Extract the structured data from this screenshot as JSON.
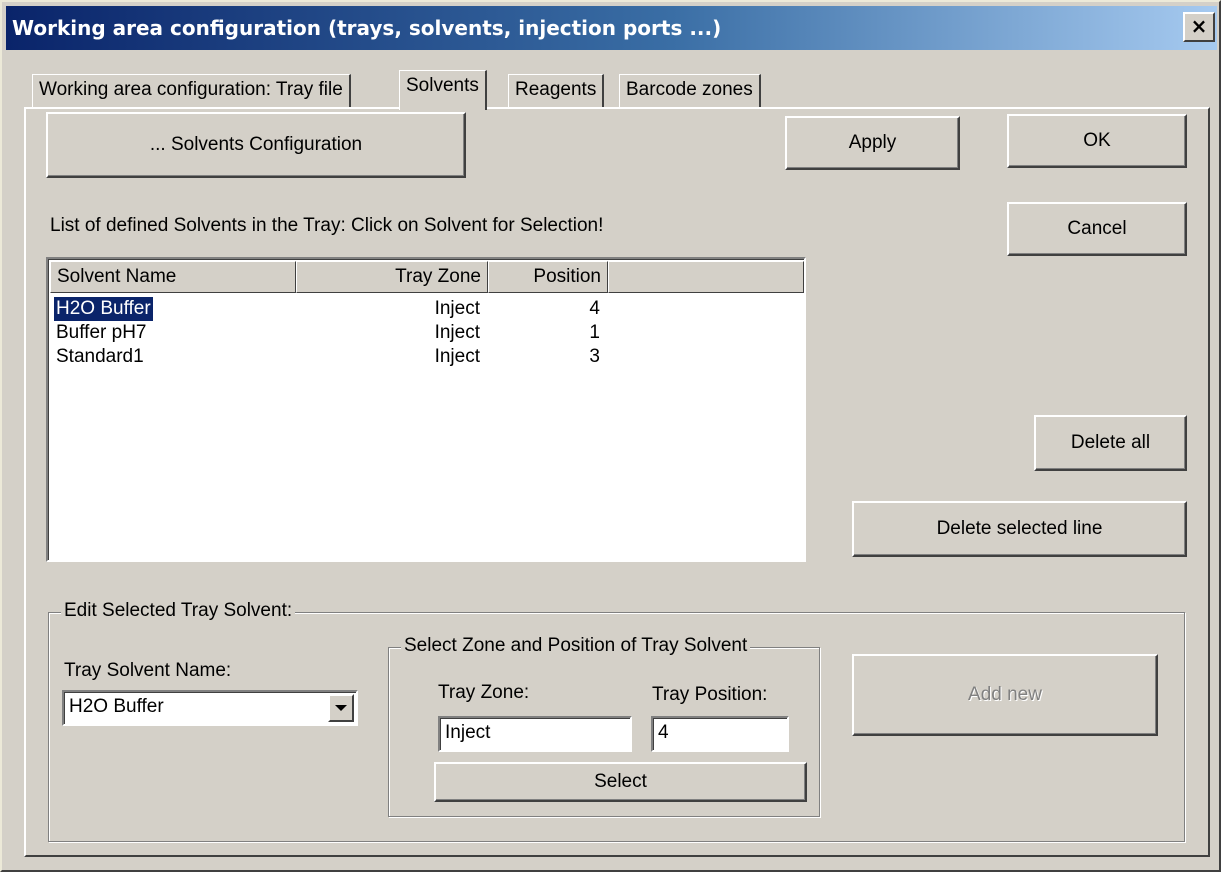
{
  "window": {
    "title": "Working area configuration (trays, solvents, injection ports ...)",
    "close_glyph": "×"
  },
  "tabs": [
    {
      "label": "Working area configuration: Tray file"
    },
    {
      "label": "Solvents",
      "active": true
    },
    {
      "label": "Reagents"
    },
    {
      "label": "Barcode zones"
    }
  ],
  "buttons": {
    "solvents_config": "... Solvents Configuration",
    "apply": "Apply",
    "ok": "OK",
    "cancel": "Cancel",
    "delete_all": "Delete all",
    "delete_selected": "Delete selected line",
    "add_new": "Add new",
    "select": "Select"
  },
  "list_caption": "List of defined Solvents in the Tray:  Click on Solvent for Selection!",
  "solvents_table": {
    "columns": [
      "Solvent Name",
      "Tray Zone",
      "Position"
    ],
    "rows": [
      {
        "name": "H2O Buffer",
        "zone": "Inject",
        "position": "4"
      },
      {
        "name": "Buffer pH7",
        "zone": "Inject",
        "position": "1"
      },
      {
        "name": "Standard1",
        "zone": "Inject",
        "position": "3"
      }
    ],
    "selected_row": 0
  },
  "edit_group": {
    "legend": "Edit Selected Tray Solvent:",
    "solvent_name_label": "Tray Solvent Name:",
    "solvent_name_value": "H2O Buffer",
    "zone_group": {
      "legend": "Select Zone and Position of Tray Solvent",
      "zone_label": "Tray Zone:",
      "zone_value": "Inject",
      "position_label": "Tray Position:",
      "position_value": "4"
    }
  },
  "colors": {
    "dialog_bg": "#d4d0c8",
    "title_start": "#0a246a",
    "title_end": "#a6caf0",
    "selection": "#0a246a"
  }
}
